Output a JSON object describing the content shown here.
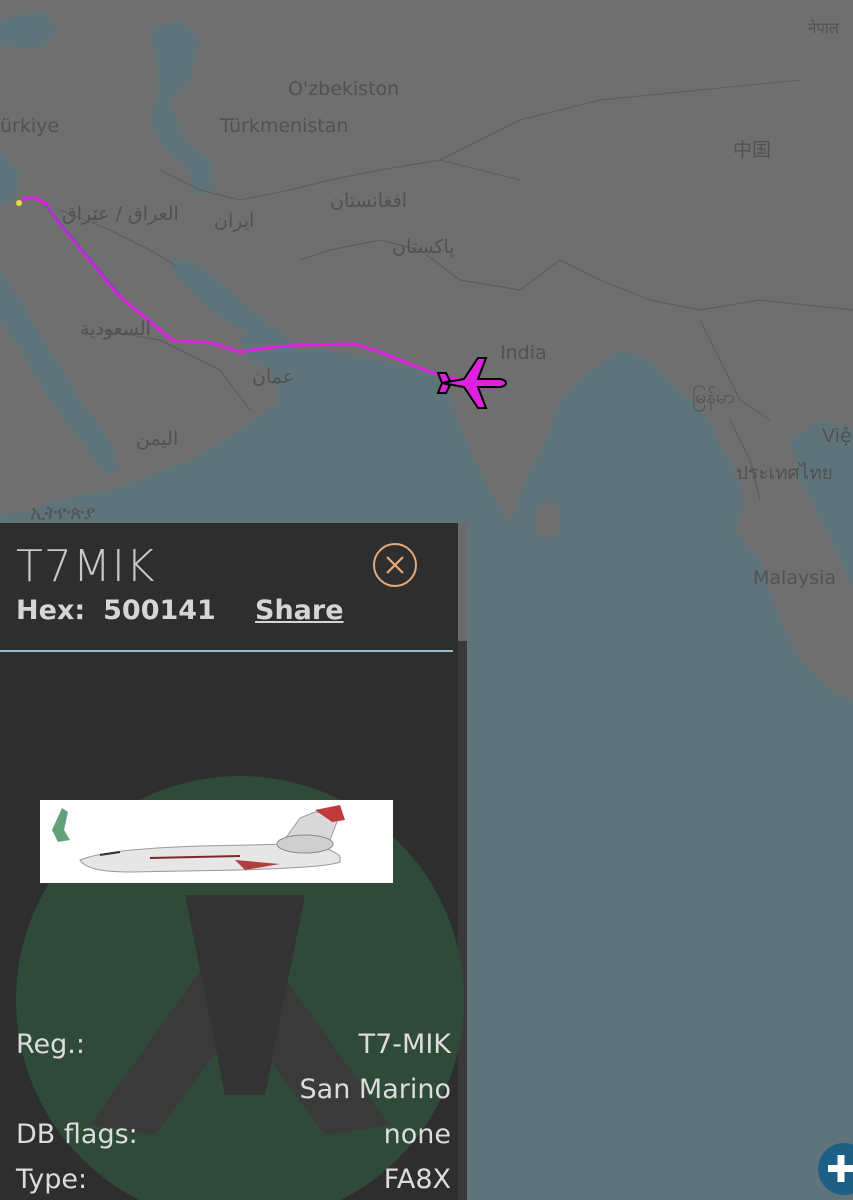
{
  "map": {
    "labels": {
      "turkiye": "ürkiye",
      "uzbekistan": "O'zbekiston",
      "turkmenistan": "Türkmenistan",
      "iraq": "العراق / عێراق",
      "iran": "ایران",
      "afghanistan": "افغانستان",
      "pakistan": "پاکستان",
      "saudi": "السعودية",
      "oman": "عمان",
      "yemen": "اليمن",
      "india": "India",
      "china": "中国",
      "myanmar": "မြန်မာ",
      "thailand": "ประเทศไทย",
      "vietnam": "Việ",
      "malaysia": "Malaysia",
      "ethiopia": "ኢትዮጵያ",
      "nepal": "नेपाल"
    },
    "track_color": "#e020e0",
    "aircraft_icon": "airplane-icon"
  },
  "panel": {
    "callsign": "T7MIK",
    "hex_label": "Hex:",
    "hex_value": "500141",
    "share_label": "Share",
    "close_icon": "close-icon",
    "accent_color": "#e7a977",
    "rows": [
      {
        "key": "Reg.:",
        "value": "T7-MIK"
      },
      {
        "key": "",
        "value": "San Marino"
      },
      {
        "key": "DB flags:",
        "value": "none"
      },
      {
        "key": "Type:",
        "value": "FA8X"
      }
    ]
  },
  "controls": {
    "zoom_in_icon": "plus-icon"
  }
}
